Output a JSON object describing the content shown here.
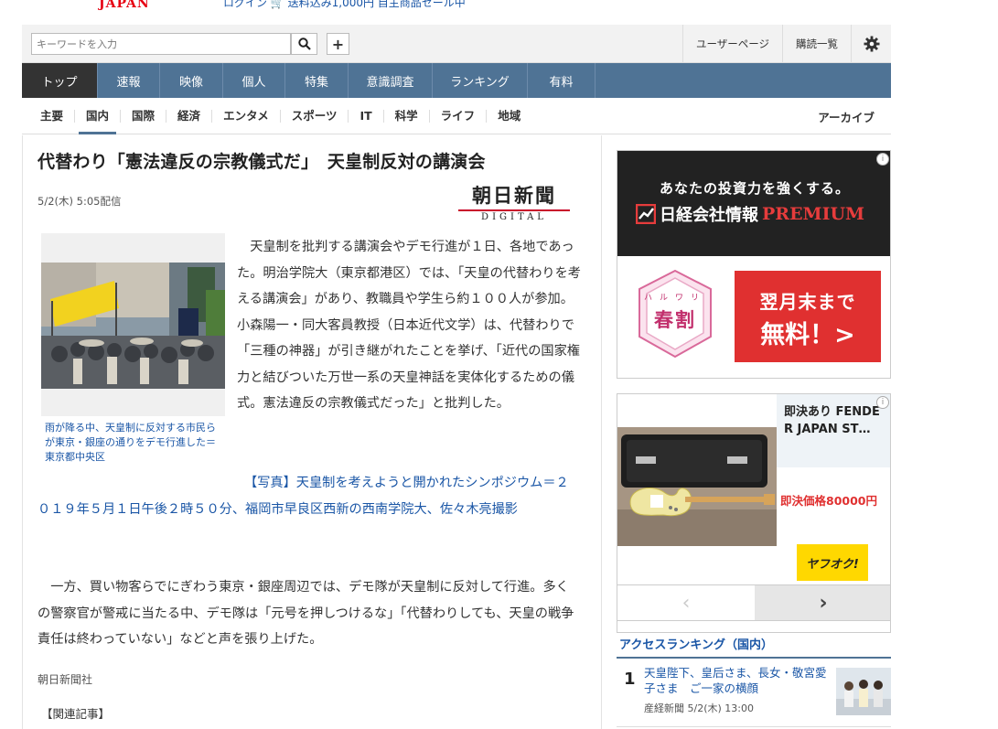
{
  "topbar": {
    "logo_text": "JAPAN",
    "promo_login": "ログイン",
    "promo_text": "送料込み1,000円 自主商品セール中"
  },
  "search": {
    "placeholder": "キーワードを入力"
  },
  "utility_links": {
    "user_page": "ユーザーページ",
    "subscriptions": "購読一覧"
  },
  "main_nav": [
    {
      "label": "トップ",
      "active": true
    },
    {
      "label": "速報"
    },
    {
      "label": "映像"
    },
    {
      "label": "個人"
    },
    {
      "label": "特集"
    },
    {
      "label": "意識調査"
    },
    {
      "label": "ランキング"
    },
    {
      "label": "有料"
    }
  ],
  "sub_nav": {
    "items": [
      {
        "label": "主要"
      },
      {
        "label": "国内",
        "active": true
      },
      {
        "label": "国際"
      },
      {
        "label": "経済"
      },
      {
        "label": "エンタメ"
      },
      {
        "label": "スポーツ"
      },
      {
        "label": "IT"
      },
      {
        "label": "科学"
      },
      {
        "label": "ライフ"
      },
      {
        "label": "地域"
      }
    ],
    "archive": "アーカイブ"
  },
  "article": {
    "headline": "代替わり「憲法違反の宗教儀式だ」　天皇制反対の講演会",
    "date": "5/2(木) 5:05配信",
    "brand_main": "朝日新聞",
    "brand_sub": "DIGITAL",
    "photo_caption": "雨が降る中、天皇制に反対する市民らが東京・銀座の通りをデモ行進した＝東京都中央区",
    "para1": "天皇制を批判する講演会やデモ行進が１日、各地であった。明治学院大（東京都港区）では、「天皇の代替わりを考える講演会」があり、教職員や学生ら約１００人が参加。小森陽一・同大客員教授（日本近代文学）は、代替わりで「三種の神器」が引き継がれたことを挙げ、「近代の国家権力と結びついた万世一系の天皇神話を実体化するための儀式。憲法違反の宗教儀式だった」と批判した。",
    "photo_link": "【写真】天皇制を考えようと開かれたシンポジウム＝２０１９年５月１日午後２時５０分、福岡市早良区西新の西南学院大、佐々木亮撮影",
    "para2": "一方、買い物客らでにぎわう東京・銀座周辺では、デモ隊が天皇制に反対して行進。多くの警察官が警戒に当たる中、デモ隊は「元号を押しつけるな」「代替わりしても、天皇の戦争責任は終わっていない」などと声を張り上げた。",
    "source": "朝日新聞社",
    "related": "【関連記事】"
  },
  "ad1": {
    "tagline": "あなたの投資力を強くする。",
    "brand_name": "日経会社情報",
    "brand_premium": "PREMIUM",
    "campaign_small": "ハルワリ",
    "campaign_big": "春割",
    "cta_line1": "翌月末まで",
    "cta_line2": "無料！>"
  },
  "ad2": {
    "title": "即決あり FENDER JAPAN ST…",
    "price": "即決価格80000円",
    "badge": "ヤフオク!"
  },
  "ranking": {
    "title": "アクセスランキング（国内）",
    "items": [
      {
        "rank": "1",
        "text": "天皇陛下、皇后さま、長女・敬宮愛子さま　ご一家の横顔",
        "meta": "産経新聞 5/2(木) 13:00"
      }
    ]
  },
  "colors": {
    "nav_blue": "#4f7395",
    "link_blue": "#1a56a6",
    "accent_red": "#e03030"
  }
}
